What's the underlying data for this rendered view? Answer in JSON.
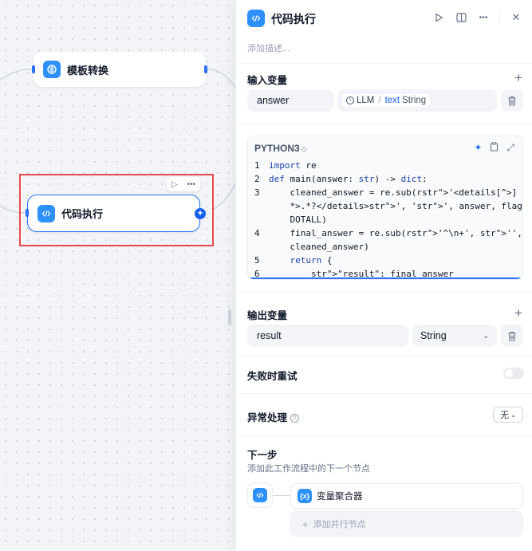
{
  "canvas": {
    "nodes": [
      {
        "label": "模板转换",
        "icon": "template-transform-icon"
      },
      {
        "label": "代码执行",
        "icon": "code-icon"
      }
    ]
  },
  "panel": {
    "title": "代码执行",
    "description_placeholder": "添加描述...",
    "input_section": {
      "title": "输入变量",
      "variables": [
        {
          "name": "answer",
          "source_node": "LLM",
          "source_var": "text",
          "source_type": "String"
        }
      ]
    },
    "code_editor": {
      "language": "PYTHON3",
      "lines": [
        {
          "num": "1",
          "text": "import re"
        },
        {
          "num": "2",
          "text": "def main(answer: str) -> dict:"
        },
        {
          "num": "3",
          "text": "    cleaned_answer = re.sub(r'<details[^>]"
        },
        {
          "num": "",
          "text": "    *>.*?</details>', '', answer, flags=re."
        },
        {
          "num": "",
          "text": "    DOTALL)"
        },
        {
          "num": "4",
          "text": "    final_answer = re.sub(r'^\\n+', '',"
        },
        {
          "num": "",
          "text": "    cleaned_answer)"
        },
        {
          "num": "5",
          "text": "    return {"
        },
        {
          "num": "6",
          "text": "        \"result\": final_answer"
        }
      ]
    },
    "output_section": {
      "title": "输出变量",
      "variables": [
        {
          "name": "result",
          "type": "String"
        }
      ]
    },
    "retry": {
      "label": "失败时重试",
      "enabled": false
    },
    "error_handling": {
      "label": "异常处理",
      "value": "无"
    },
    "next_step": {
      "title": "下一步",
      "description": "添加此工作流程中的下一个节点",
      "next_node": "变量聚合器",
      "add_parallel": "添加并行节点"
    }
  },
  "colors": {
    "accent": "#2970ff",
    "node_icon": "#2e90fa",
    "selection": "#e5484d"
  }
}
